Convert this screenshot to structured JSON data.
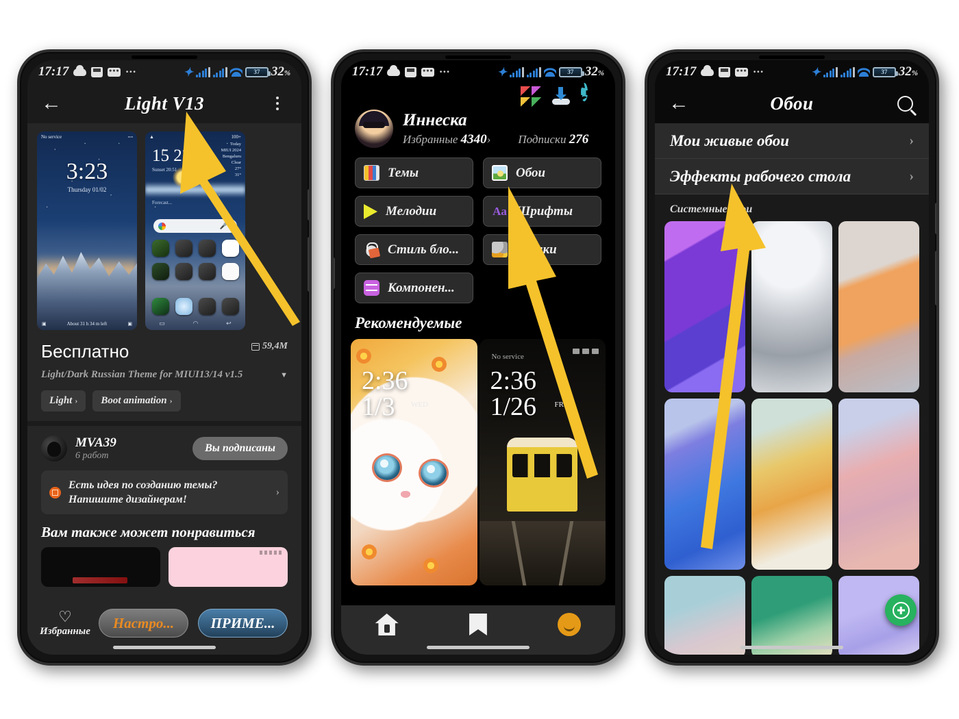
{
  "meta": {
    "accent_yellow": "#f5c22b",
    "bg": "#ffffff"
  },
  "statusbar": {
    "time": "17:17",
    "battery_percent": "32",
    "percent_symbol": "%",
    "battery_inner": "37",
    "icons_left": [
      "cloud-icon",
      "sd-card-icon",
      "message-icon",
      "more-dots-icon"
    ],
    "icons_right": [
      "bluetooth-icon",
      "signal-bars-icon",
      "signal-bars-2-icon",
      "wifi-icon",
      "battery-icon"
    ]
  },
  "phone1": {
    "appbar": {
      "back": "←",
      "title": "Light V13",
      "menu": "kebab-menu-icon"
    },
    "preview1": {
      "status_left": "No service",
      "clock": "3:23",
      "date": "Thursday 01/02",
      "footer": "About 31 h 34 m left"
    },
    "preview2": {
      "clock_h": "15",
      "clock_m": "23",
      "sunset": "Sunset 20:51",
      "weather": "Today\nMIUI 2024\nBengaluru\nClear\n27°\n31°",
      "forecast": "Forecast...",
      "battery": "100+"
    },
    "price": "Бесплатно",
    "size": "59,4M",
    "description": "Light/Dark Russian Theme for MIUI13/14 v1.5",
    "chips": [
      {
        "label": "Light",
        "arrow": "›"
      },
      {
        "label": "Boot animation",
        "arrow": "›"
      }
    ],
    "author": {
      "name": "MVA39",
      "works": "6 работ",
      "subscribe_label": "Вы подписаны"
    },
    "idea_box": {
      "line1": "Есть идея по созданию темы?",
      "line2": "Напишите дизайнерам!",
      "chevron": "›"
    },
    "also_like_title": "Вам также может понравиться",
    "bottom": {
      "favorites_label": "Избранные",
      "heart_icon": "heart-outline-icon",
      "settings_button": "Настро...",
      "apply_button": "ПРИМЕ..."
    }
  },
  "phone2": {
    "top_icons": [
      "gift-blocks-icon",
      "download-icon",
      "gear-icon"
    ],
    "profile": {
      "name": "Иннеска",
      "favorites_label": "Избранные",
      "favorites_count": "4340",
      "favorites_arrow": "›",
      "subscriptions_label": "Подписки",
      "subscriptions_count": "276"
    },
    "menu": [
      {
        "label": "Темы",
        "icon": "themes-icon"
      },
      {
        "label": "Обои",
        "icon": "wallpaper-icon"
      },
      {
        "label": "Мелодии",
        "icon": "ringtone-icon"
      },
      {
        "label": "Шрифты",
        "icon": "font-icon"
      },
      {
        "label": "Стиль бло...",
        "icon": "lockscreen-style-icon"
      },
      {
        "label": "Значки",
        "icon": "app-icons-icon"
      },
      {
        "label": "Компонен...",
        "icon": "components-icon"
      }
    ],
    "recommended_title": "Рекомендуемые",
    "cards": [
      {
        "name": "cat-wallpaper",
        "clock": "2:36",
        "date": "1/3",
        "dow": "WED"
      },
      {
        "name": "train-wallpaper",
        "clock": "2:36",
        "date": "1/26",
        "dow": "FRI",
        "carrier": "No service"
      }
    ],
    "navbar": [
      "home-icon",
      "bookmark-icon",
      "profile-avatar-icon"
    ]
  },
  "phone3": {
    "appbar": {
      "back": "←",
      "title": "Обои",
      "search": "search-icon"
    },
    "rows": [
      {
        "label": "Мои живые обои",
        "chevron": "›"
      },
      {
        "label": "Эффекты рабочего стола",
        "chevron": "›"
      }
    ],
    "section_label": "Системные обои",
    "wallpapers_row1": [
      "#8b3fe0",
      "#c9ccd2",
      "#e8a46c"
    ],
    "wallpapers_row2": [
      "#3f78e0",
      "#d8d0a0",
      "#e8b0b6"
    ],
    "wallpapers_row3": [
      "#a8cfd8",
      "#3f9e7a",
      "#b0a8e8"
    ],
    "fab": {
      "icon": "add-circle-icon"
    }
  },
  "arrows": [
    {
      "name": "arrow-to-theme-title",
      "target": "Light V13 title"
    },
    {
      "name": "arrow-to-wallpapers-button",
      "target": "Обои button"
    },
    {
      "name": "arrow-to-desktop-effects",
      "target": "Эффекты рабочего стола"
    }
  ]
}
